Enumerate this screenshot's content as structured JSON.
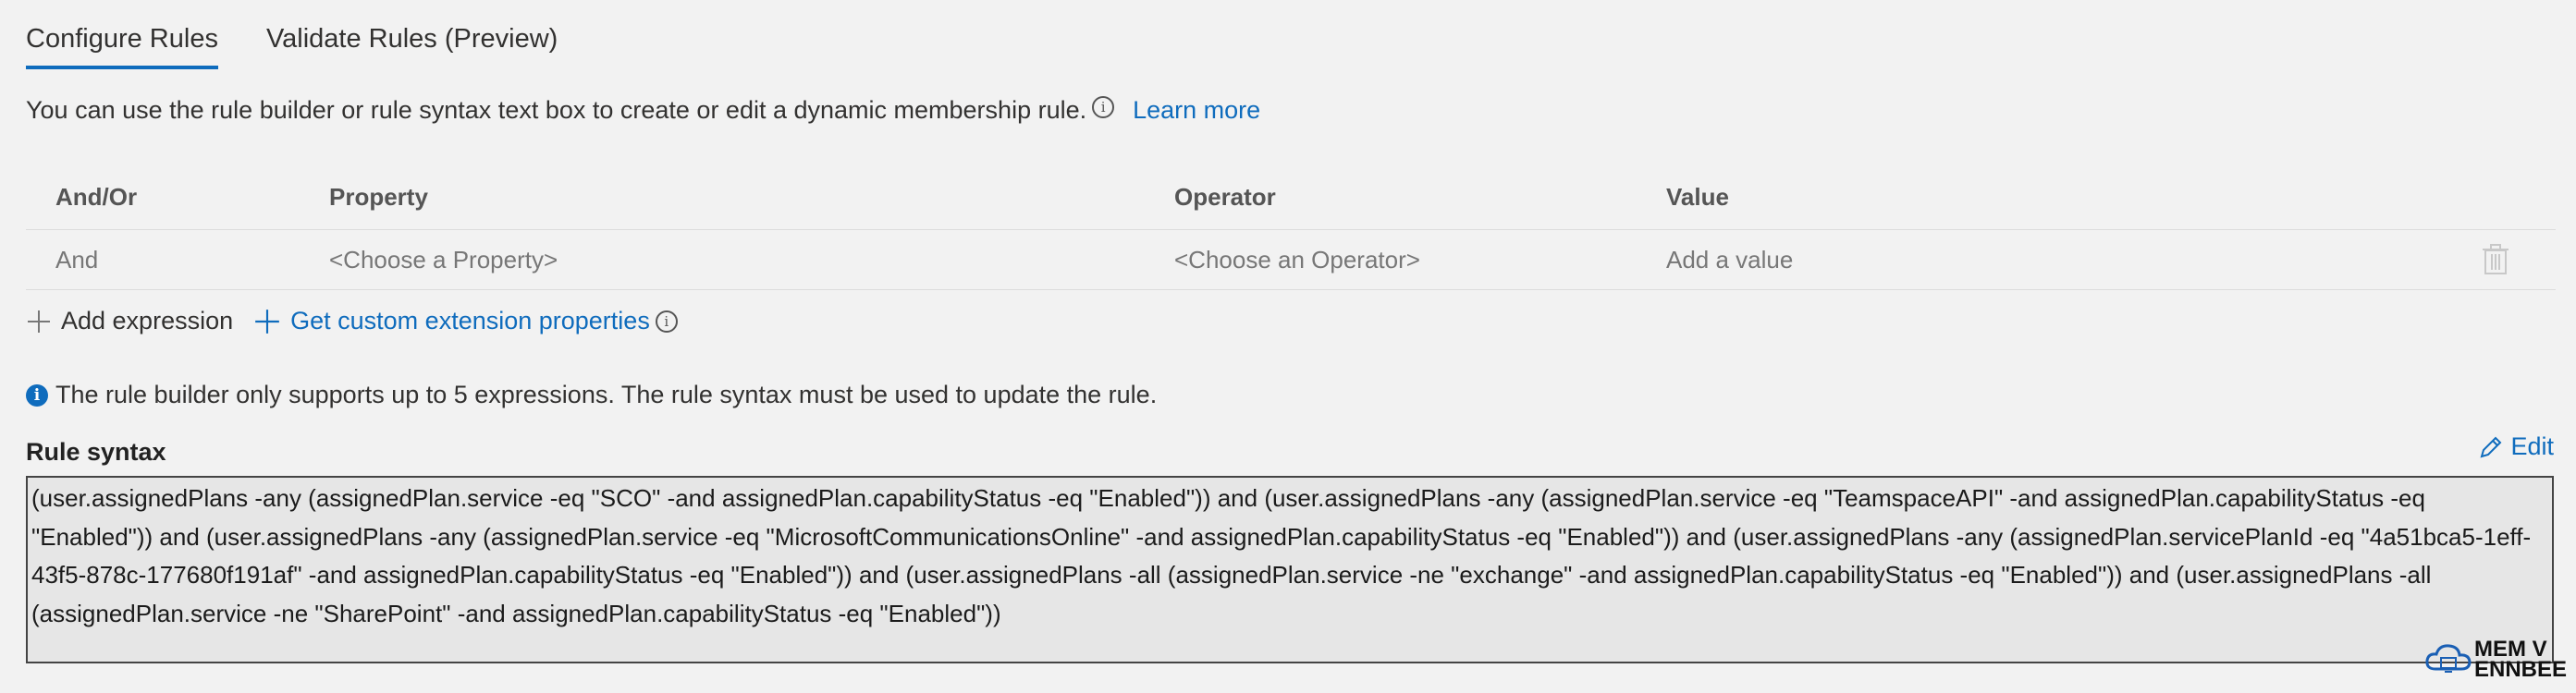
{
  "tabs": [
    {
      "label": "Configure Rules",
      "active": true
    },
    {
      "label": "Validate Rules (Preview)",
      "active": false
    }
  ],
  "intro": {
    "text": "You can use the rule builder or rule syntax text box to create or edit a dynamic membership rule.",
    "learn_more": "Learn more"
  },
  "grid": {
    "headers": [
      "And/Or",
      "Property",
      "Operator",
      "Value"
    ],
    "row": {
      "andor": "And",
      "property_placeholder": "<Choose a Property>",
      "operator_placeholder": "<Choose an Operator>",
      "value_placeholder": "Add a value"
    }
  },
  "actions": {
    "add_expression": "Add expression",
    "custom_ext": "Get custom extension properties"
  },
  "notice": "The rule builder only supports up to 5 expressions. The rule syntax must be used to update the rule.",
  "rule_syntax": {
    "label": "Rule syntax",
    "edit_label": "Edit",
    "text": "(user.assignedPlans -any (assignedPlan.service -eq \"SCO\" -and assignedPlan.capabilityStatus -eq \"Enabled\")) and (user.assignedPlans -any (assignedPlan.service -eq \"TeamspaceAPI\" -and assignedPlan.capabilityStatus -eq \"Enabled\")) and (user.assignedPlans -any (assignedPlan.service -eq \"MicrosoftCommunicationsOnline\" -and assignedPlan.capabilityStatus -eq \"Enabled\")) and (user.assignedPlans -any (assignedPlan.servicePlanId -eq \"4a51bca5-1eff-43f5-878c-177680f191af\" -and assignedPlan.capabilityStatus -eq \"Enabled\")) and (user.assignedPlans -all (assignedPlan.service -ne \"exchange\" -and assignedPlan.capabilityStatus -eq \"Enabled\")) and (user.assignedPlans -all (assignedPlan.service -ne \"SharePoint\" -and assignedPlan.capabilityStatus -eq \"Enabled\"))"
  },
  "watermark": {
    "line1": "MEM V",
    "line2": "ENNBEE"
  },
  "colors": {
    "accent": "#0f6cbd",
    "background": "#f2f2f2",
    "syntax_bg": "#e6e6e6"
  },
  "icons": [
    "info-icon",
    "plus-icon",
    "trash-icon",
    "pencil-icon",
    "info-filled-icon",
    "cloud-logo-icon"
  ]
}
